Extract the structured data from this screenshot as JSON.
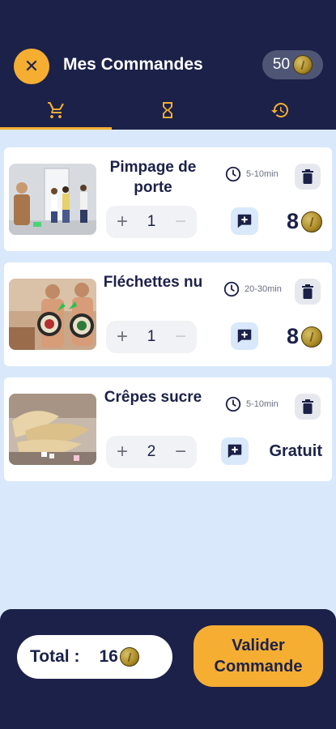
{
  "header": {
    "title": "Mes Commandes",
    "balance": "50",
    "colors": {
      "background": "#1c2149",
      "accent": "#f5ae32"
    }
  },
  "tabs": [
    {
      "icon": "cart-icon",
      "active": true
    },
    {
      "icon": "hourglass-icon",
      "active": false
    },
    {
      "icon": "history-icon",
      "active": false
    }
  ],
  "orders": [
    {
      "name": "Pimpage de porte",
      "time": "5-10min",
      "quantity": "1",
      "price": "8"
    },
    {
      "name": "Fléchettes nu",
      "time": "20-30min",
      "quantity": "1",
      "price": "8"
    },
    {
      "name": "Crêpes sucre",
      "time": "5-10min",
      "quantity": "2",
      "price": "Gratuit"
    }
  ],
  "footer": {
    "total_label": "Total :",
    "total_value": "16",
    "validate_label": "Valider Commande"
  }
}
